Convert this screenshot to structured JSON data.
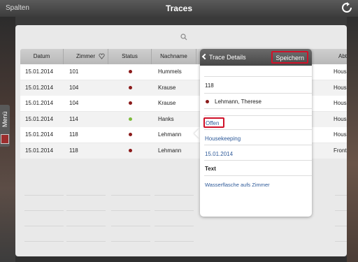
{
  "topbar": {
    "left_label": "Spalten",
    "title": "Traces",
    "refresh_icon": "refresh-icon"
  },
  "side_menu": {
    "label": "Menü",
    "icon": "hotel-logo-icon"
  },
  "search": {
    "icon": "search-icon"
  },
  "grid": {
    "columns": [
      "Datum",
      "Zimmer",
      "Status",
      "Nachname",
      "Abte"
    ],
    "rows": [
      {
        "datum": "15.01.2014",
        "zimmer": "101",
        "status_color": "#8b1a1a",
        "nachname": "Hummels",
        "abteilung": "House"
      },
      {
        "datum": "15.01.2014",
        "zimmer": "104",
        "status_color": "#8b1a1a",
        "nachname": "Krause",
        "abteilung": "House"
      },
      {
        "datum": "15.01.2014",
        "zimmer": "104",
        "status_color": "#8b1a1a",
        "nachname": "Krause",
        "abteilung": "House"
      },
      {
        "datum": "15.01.2014",
        "zimmer": "114",
        "status_color": "#7dbb3c",
        "nachname": "Hanks",
        "abteilung": "House"
      },
      {
        "datum": "15.01.2014",
        "zimmer": "118",
        "status_color": "#8b1a1a",
        "nachname": "Lehmann",
        "abteilung": "House"
      },
      {
        "datum": "15.01.2014",
        "zimmer": "118",
        "status_color": "#8b1a1a",
        "nachname": "Lehmann",
        "abteilung": "Front C"
      }
    ]
  },
  "popover": {
    "back_label": "Trace Details",
    "save_label": "Speichern",
    "room": "118",
    "guest": "Lehmann, Therese",
    "guest_status_color": "#8b1a1a",
    "status": "Offen",
    "department": "Housekeeping",
    "date": "15.01.2014",
    "text_heading": "Text",
    "text_value": "Wasserflasche aufs Zimmer"
  },
  "colors": {
    "accent": "#2e5a99",
    "highlight_box": "#d0122a"
  }
}
